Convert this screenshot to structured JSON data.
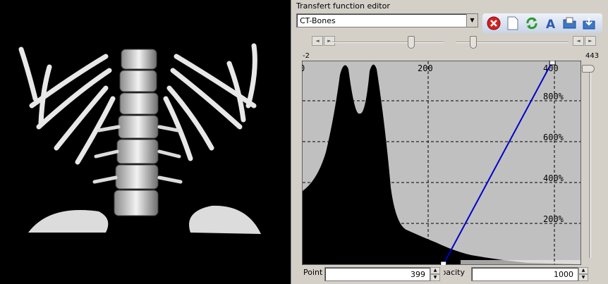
{
  "panel": {
    "title": "Transfert function editor"
  },
  "preset": {
    "selected": "CT-Bones"
  },
  "toolbar": {
    "icons": [
      "delete-icon",
      "new-file-icon",
      "refresh-icon",
      "text-a-icon",
      "open-folder-icon",
      "save-icon"
    ]
  },
  "graph": {
    "range_min": "-2",
    "range_max": "443",
    "x_ticks": [
      "0",
      "200",
      "400"
    ],
    "y_ticks": [
      "800%",
      "600%",
      "400%",
      "200%"
    ],
    "line_color": "#0000cc",
    "background_color": "#c0c0c0",
    "histogram_color": "#000000",
    "control_points": [
      {
        "x": 225,
        "opacity_percent": 0
      },
      {
        "x": 399,
        "opacity_percent": 1000
      }
    ]
  },
  "fields": {
    "point_label": "Point",
    "point_value": "399",
    "opacity_label": "Opacity",
    "opacity_value": "1000"
  },
  "chart_data": {
    "type": "area",
    "xlim": [
      0,
      443
    ],
    "ylim": [
      0,
      1000
    ],
    "x_ticks": [
      0,
      200,
      400
    ],
    "y_ticks": [
      200,
      400,
      600,
      800
    ],
    "transfer_line": {
      "x": [
        225,
        399
      ],
      "y": [
        0,
        1000
      ]
    }
  }
}
